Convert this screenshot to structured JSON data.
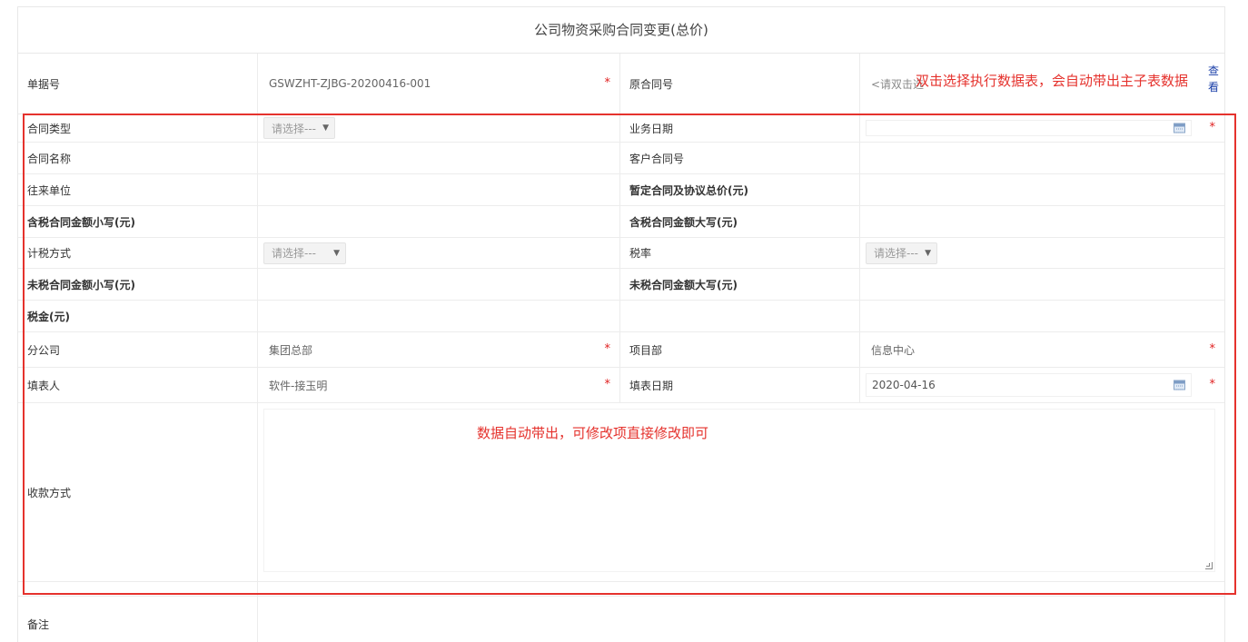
{
  "form_title": "公司物资采购合同变更(总价)",
  "annotations": {
    "top_right": "双击选择执行数据表，会自动带出主子表数据",
    "middle": "数据自动带出，可修改项直接修改即可",
    "accent_color": "#e5322d"
  },
  "fields": {
    "doc_no_label": "单据号",
    "doc_no_value": "GSWZHT-ZJBG-20200416-001",
    "orig_contract_label": "原合同号",
    "orig_contract_placeholder": "<请双击选",
    "view_link": [
      "查",
      "看"
    ],
    "contract_type_label": "合同类型",
    "contract_type_value": "请选择---",
    "biz_date_label": "业务日期",
    "contract_name_label": "合同名称",
    "customer_contract_label": "客户合同号",
    "partner_label": "往来单位",
    "provisional_total_label": "暂定合同及协议总价(元)",
    "tax_incl_small_label": "含税合同金额小写(元)",
    "tax_incl_big_label": "含税合同金额大写(元)",
    "tax_method_label": "计税方式",
    "tax_method_value": "请选择---",
    "tax_rate_label": "税率",
    "tax_rate_value": "请选择---",
    "tax_excl_small_label": "未税合同金额小写(元)",
    "tax_excl_big_label": "未税合同金额大写(元)",
    "tax_amount_label": "税金(元)",
    "branch_label": "分公司",
    "branch_value": "集团总部",
    "project_dept_label": "项目部",
    "project_dept_value": "信息中心",
    "filler_label": "填表人",
    "filler_value": "软件-接玉明",
    "fill_date_label": "填表日期",
    "fill_date_value": "2020-04-16",
    "payment_method_label": "收款方式",
    "remark_label": "备注",
    "required_mark": "*"
  }
}
